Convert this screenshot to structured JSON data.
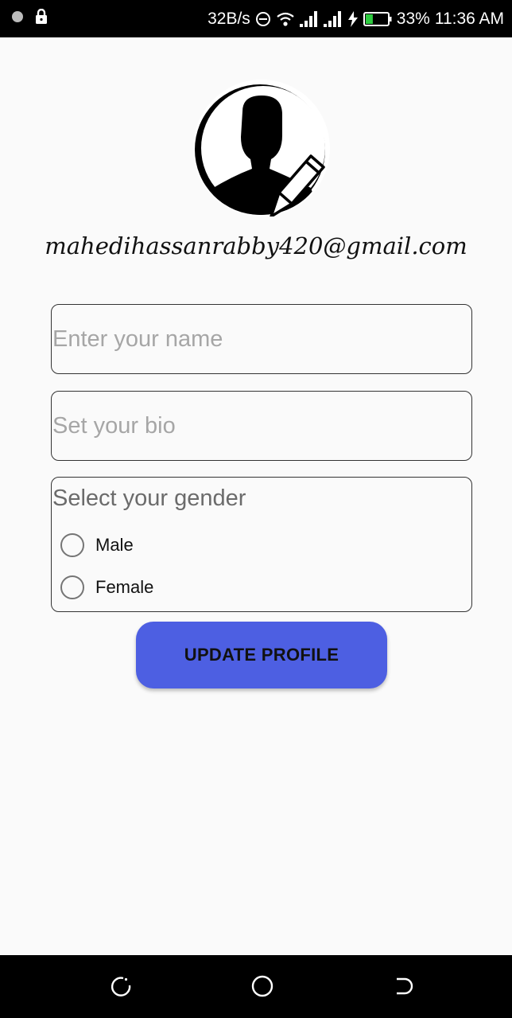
{
  "status_bar": {
    "net_speed": "32B/s",
    "battery_percent": "33%",
    "time": "11:36 AM",
    "battery_level": 0.33,
    "battery_color": "#2ecc40"
  },
  "profile": {
    "email": "mahedihassanrabby420@gmail.com",
    "avatar_icon": "person-silhouette-icon",
    "edit_icon": "pencil-icon"
  },
  "form": {
    "name_placeholder": "Enter your name",
    "name_value": "",
    "bio_placeholder": "Set your bio",
    "bio_value": "",
    "gender_title": "Select your gender",
    "gender_options": [
      {
        "label": "Male",
        "selected": false
      },
      {
        "label": "Female",
        "selected": false
      }
    ],
    "update_label": "UPDATE PROFILE",
    "update_color": "#4d5fe2"
  },
  "nav": {
    "back_icon": "back-icon",
    "home_icon": "home-icon",
    "recent_icon": "recent-apps-icon"
  }
}
